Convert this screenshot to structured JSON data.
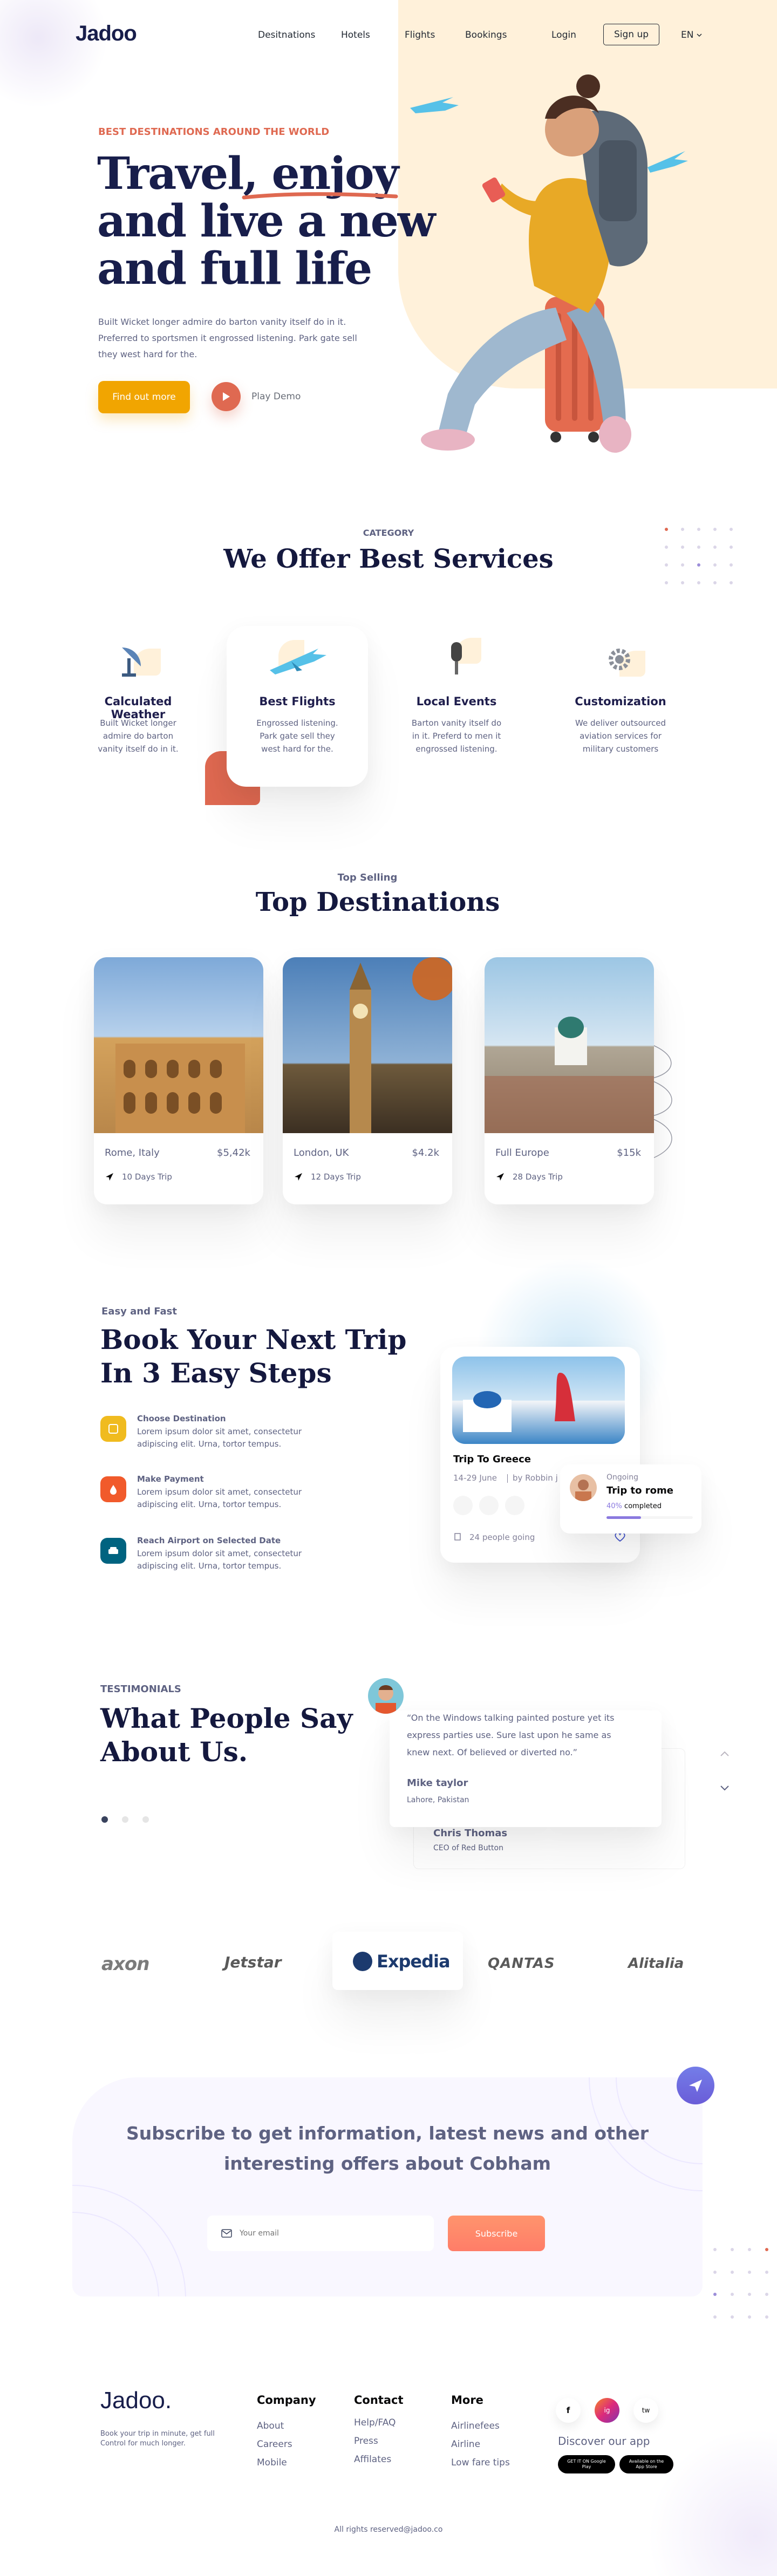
{
  "nav": {
    "logo": "Jadoo",
    "items": [
      "Desitnations",
      "Hotels",
      "Flights",
      "Bookings"
    ],
    "login": "Login",
    "signup": "Sign up",
    "lang": "EN"
  },
  "hero": {
    "eyebrow": "BEST DESTINATIONS AROUND THE WORLD",
    "title_line1a": "Travel, ",
    "title_line1b": "enjoy",
    "title_line2": "and live a new",
    "title_line3": "and full life",
    "body": "Built Wicket longer admire do barton vanity itself do in it. Preferred to sportsmen it engrossed listening. Park gate sell they west hard for the.",
    "cta": "Find out more",
    "play": "Play Demo"
  },
  "services": {
    "eyebrow": "CATEGORY",
    "title": "We Offer Best Services",
    "items": [
      {
        "title": "Calculated Weather",
        "text": "Built Wicket longer admire do barton vanity itself do in it.",
        "icon": "satellite-dish-icon"
      },
      {
        "title": "Best Flights",
        "text": "Engrossed listening. Park gate sell they west hard for the.",
        "icon": "airplane-icon"
      },
      {
        "title": "Local Events",
        "text": "Barton vanity itself do in it. Preferd to men it engrossed listening.",
        "icon": "microphone-icon"
      },
      {
        "title": "Customization",
        "text": "We deliver outsourced aviation services for military customers",
        "icon": "gear-icon"
      }
    ]
  },
  "destinations": {
    "eyebrow": "Top Selling",
    "title": "Top Destinations",
    "items": [
      {
        "name": "Rome, Italy",
        "price": "$5,42k",
        "trip": "10 Days Trip"
      },
      {
        "name": "London, UK",
        "price": "$4.2k",
        "trip": "12 Days Trip"
      },
      {
        "name": "Full Europe",
        "price": "$15k",
        "trip": "28 Days Trip"
      }
    ]
  },
  "booking": {
    "eyebrow": "Easy and Fast",
    "title_line1": "Book Your Next Trip",
    "title_line2": "In 3 Easy Steps",
    "steps": [
      {
        "title": "Choose Destination",
        "text": "Lorem ipsum dolor sit amet, consectetur adipiscing elit. Urna, tortor tempus.",
        "color": "#f0bb1f"
      },
      {
        "title": "Make Payment",
        "text": "Lorem ipsum dolor sit amet, consectetur adipiscing elit. Urna, tortor tempus.",
        "color": "#f15a2b"
      },
      {
        "title": "Reach Airport on Selected Date",
        "text": "Lorem ipsum dolor sit amet, consectetur adipiscing elit. Urna, tortor tempus.",
        "color": "#006380"
      }
    ],
    "trip_card": {
      "title": "Trip To Greece",
      "dates": "14-29 June",
      "by": "by Robbin j",
      "people": "24 people going"
    },
    "ongoing": {
      "label": "Ongoing",
      "title": "Trip to rome",
      "percent": "40%",
      "percent_word": "completed",
      "progress": 0.4
    }
  },
  "testimonials": {
    "eyebrow": "TESTIMONIALS",
    "title_line1": "What People Say",
    "title_line2": "About Us.",
    "quote": "“On the Windows talking painted posture yet its express parties use. Sure last upon he same as knew next. Of believed or diverted no.”",
    "name": "Mike taylor",
    "location": "Lahore, Pakistan",
    "back_name": "Chris Thomas",
    "back_role": "CEO of Red Button"
  },
  "partners": [
    "axon",
    "Jetstar",
    "Expedia",
    "QANTAS",
    "Alitalia"
  ],
  "subscribe": {
    "title_line1": "Subscribe to get information, latest news and other",
    "title_line2": "interesting offers about Cobham",
    "placeholder": "Your email",
    "button": "Subscribe"
  },
  "footer": {
    "logo": "Jadoo.",
    "tagline": "Book your trip in minute, get full Control for much longer.",
    "columns": [
      {
        "title": "Company",
        "links": [
          "About",
          "Careers",
          "Mobile"
        ]
      },
      {
        "title": "Contact",
        "links": [
          "Help/FAQ",
          "Press",
          "Affilates"
        ]
      },
      {
        "title": "More",
        "links": [
          "Airlinefees",
          "Airline",
          "Low fare tips"
        ]
      }
    ],
    "social": [
      "f",
      "ig",
      "tw"
    ],
    "app_title": "Discover our app",
    "google_play": "GET IT ON Google Play",
    "app_store": "Available on the App Store",
    "copyright": "All rights reserved@jadoo.co"
  },
  "colors": {
    "accent_orange": "#df6951",
    "yellow": "#f1a501",
    "navy": "#181e4b",
    "peach": "#fff1da"
  }
}
